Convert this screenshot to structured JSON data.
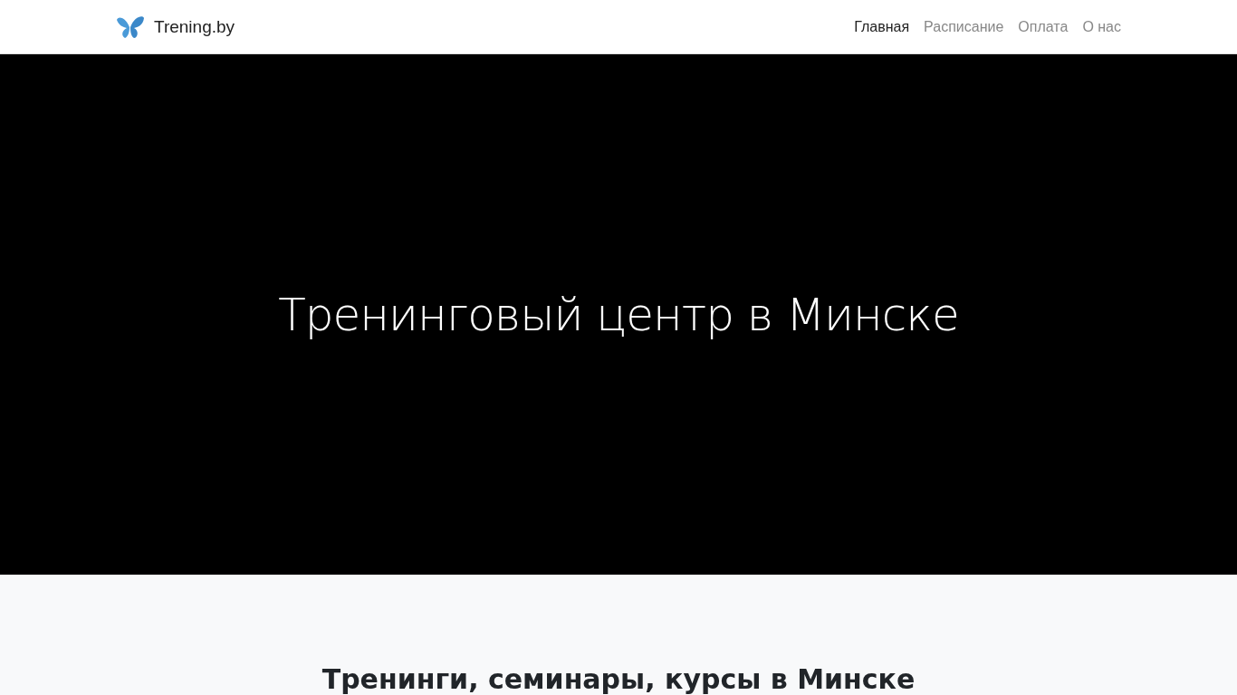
{
  "header": {
    "brand": "Trening.by",
    "nav": [
      {
        "label": "Главная",
        "selected": true
      },
      {
        "label": "Расписание",
        "selected": false
      },
      {
        "label": "Оплата",
        "selected": false
      },
      {
        "label": "О нас",
        "selected": false
      }
    ]
  },
  "hero": {
    "title": "Тренинговый центр в Минске"
  },
  "section": {
    "title": "Тренинги, семинары, курсы в Минске"
  }
}
